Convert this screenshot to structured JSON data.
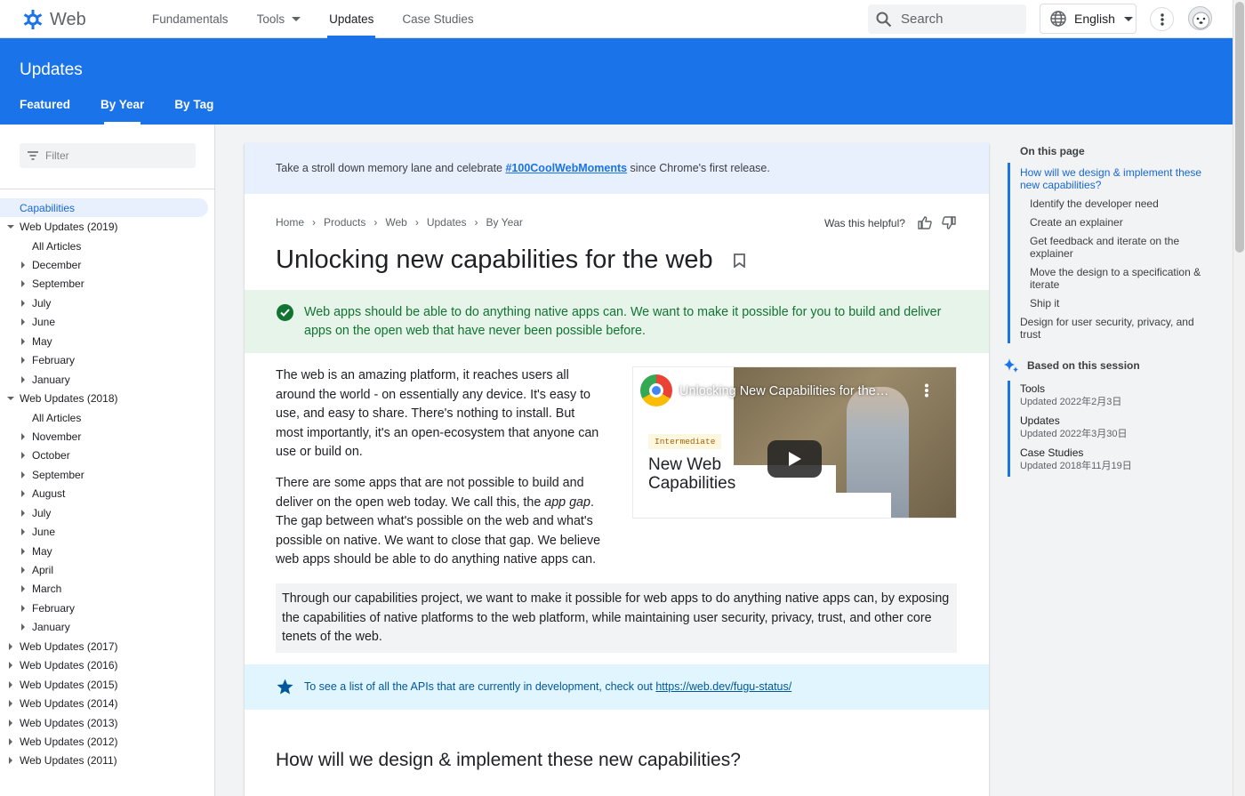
{
  "header": {
    "site_name": "Web",
    "nav": [
      "Fundamentals",
      "Tools",
      "Updates",
      "Case Studies"
    ],
    "search_placeholder": "Search",
    "language": "English"
  },
  "section": {
    "title": "Updates",
    "tabs": [
      "Featured",
      "By Year",
      "By Tag"
    ]
  },
  "sidebar": {
    "filter_placeholder": "Filter",
    "items": [
      {
        "label": "Capabilities",
        "level": 0,
        "arrow": "none",
        "selected": true
      },
      {
        "label": "Web Updates (2019)",
        "level": 0,
        "arrow": "open"
      },
      {
        "label": "All Articles",
        "level": 1,
        "arrow": "none"
      },
      {
        "label": "December",
        "level": 1,
        "arrow": "closed"
      },
      {
        "label": "September",
        "level": 1,
        "arrow": "closed"
      },
      {
        "label": "July",
        "level": 1,
        "arrow": "closed"
      },
      {
        "label": "June",
        "level": 1,
        "arrow": "closed"
      },
      {
        "label": "May",
        "level": 1,
        "arrow": "closed"
      },
      {
        "label": "February",
        "level": 1,
        "arrow": "closed"
      },
      {
        "label": "January",
        "level": 1,
        "arrow": "closed"
      },
      {
        "label": "Web Updates (2018)",
        "level": 0,
        "arrow": "open"
      },
      {
        "label": "All Articles",
        "level": 1,
        "arrow": "none"
      },
      {
        "label": "November",
        "level": 1,
        "arrow": "closed"
      },
      {
        "label": "October",
        "level": 1,
        "arrow": "closed"
      },
      {
        "label": "September",
        "level": 1,
        "arrow": "closed"
      },
      {
        "label": "August",
        "level": 1,
        "arrow": "closed"
      },
      {
        "label": "July",
        "level": 1,
        "arrow": "closed"
      },
      {
        "label": "June",
        "level": 1,
        "arrow": "closed"
      },
      {
        "label": "May",
        "level": 1,
        "arrow": "closed"
      },
      {
        "label": "April",
        "level": 1,
        "arrow": "closed"
      },
      {
        "label": "March",
        "level": 1,
        "arrow": "closed"
      },
      {
        "label": "February",
        "level": 1,
        "arrow": "closed"
      },
      {
        "label": "January",
        "level": 1,
        "arrow": "closed"
      },
      {
        "label": "Web Updates (2017)",
        "level": 0,
        "arrow": "closed"
      },
      {
        "label": "Web Updates (2016)",
        "level": 0,
        "arrow": "closed"
      },
      {
        "label": "Web Updates (2015)",
        "level": 0,
        "arrow": "closed"
      },
      {
        "label": "Web Updates (2014)",
        "level": 0,
        "arrow": "closed"
      },
      {
        "label": "Web Updates (2013)",
        "level": 0,
        "arrow": "closed"
      },
      {
        "label": "Web Updates (2012)",
        "level": 0,
        "arrow": "closed"
      },
      {
        "label": "Web Updates (2011)",
        "level": 0,
        "arrow": "closed"
      }
    ]
  },
  "article": {
    "banner_before": "Take a stroll down memory lane and celebrate ",
    "banner_link": "#100CoolWebMoments",
    "banner_after": " since Chrome's first release.",
    "breadcrumbs": [
      "Home",
      "Products",
      "Web",
      "Updates",
      "By Year"
    ],
    "helpful": "Was this helpful?",
    "title": "Unlocking new capabilities for the web",
    "success": "Web apps should be able to do anything native apps can. We want to make it possible for you to build and deliver apps on the open web that have never been possible before.",
    "para1": "The web is an amazing platform, it reaches users all around the world - on essentially any device. It's easy to use, and easy to share. There's nothing to install. But most importantly, it's an open-ecosystem that anyone can use or build on.",
    "para2_before": "There are some apps that are not possible to build and deliver on the open web today. We call this, the ",
    "para2_em": "app gap",
    "para2_after": ". The gap between what's possible on the web and what's possible on native. We want to close that gap. We believe web apps should be able to do anything native apps can.",
    "video": {
      "title": "Unlocking New Capabilities for the…",
      "chip": "Intermediate",
      "heading": "New Web Capabilities"
    },
    "quote": "Through our capabilities project, we want to make it possible for web apps to do anything native apps can, by exposing the capabilities of native platforms to the web platform, while maintaining user security, privacy, trust, and other core tenets of the web.",
    "note_before": "To see a list of all the APIs that are currently in development, check out ",
    "note_link": "https://web.dev/fugu-status/",
    "h2": "How will we design & implement these new capabilities?"
  },
  "toc": {
    "title": "On this page",
    "items": [
      {
        "label": "How will we design & implement these new capabilities?",
        "sub": false,
        "active": true
      },
      {
        "label": "Identify the developer need",
        "sub": true
      },
      {
        "label": "Create an explainer",
        "sub": true
      },
      {
        "label": "Get feedback and iterate on the explainer",
        "sub": true
      },
      {
        "label": "Move the design to a specification & iterate",
        "sub": true
      },
      {
        "label": "Ship it",
        "sub": true
      },
      {
        "label": "Design for user security, privacy, and trust",
        "sub": false
      }
    ],
    "session_title": "Based on this session",
    "session": [
      {
        "name": "Tools",
        "date": "Updated 2022年2月3日"
      },
      {
        "name": "Updates",
        "date": "Updated 2022年3月30日"
      },
      {
        "name": "Case Studies",
        "date": "Updated 2018年11月19日"
      }
    ]
  },
  "colors": {
    "brand_blue": "#1a73e8",
    "success_green": "#137333",
    "note_blue": "#01579b"
  }
}
